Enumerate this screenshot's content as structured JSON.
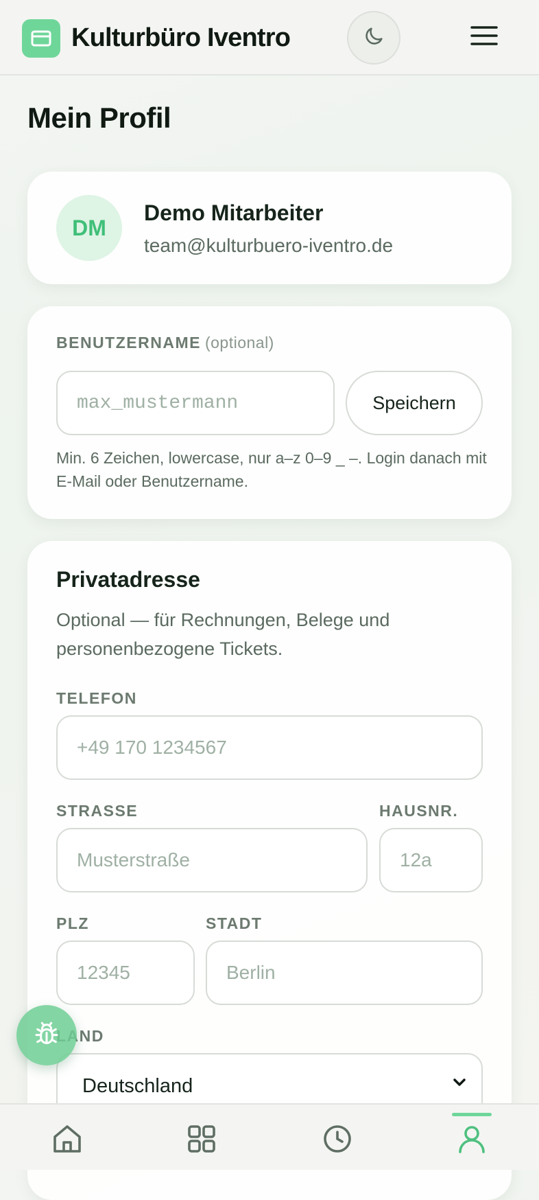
{
  "header": {
    "brand_name": "Kulturbüro Iventro",
    "logo_icon": "credit-card-icon",
    "theme_toggle_icon": "moon-icon",
    "menu_icon": "hamburger-menu-icon"
  },
  "page": {
    "title": "Mein Profil"
  },
  "profile": {
    "initials": "DM",
    "name": "Demo Mitarbeiter",
    "email": "team@kulturbuero-iventro.de"
  },
  "username": {
    "label": "BENUTZERNAME",
    "optional_label": "(optional)",
    "placeholder": "max_mustermann",
    "value": "",
    "save_label": "Speichern",
    "help": "Min. 6 Zeichen, lowercase, nur a–z 0–9 _ –. Login danach mit E-Mail oder Benutzername."
  },
  "address": {
    "title": "Privatadresse",
    "description": "Optional — für Rechnungen, Belege und personenbezogene Tickets.",
    "phone": {
      "label": "TELEFON",
      "placeholder": "+49 170 1234567"
    },
    "street": {
      "label": "STRASSE",
      "placeholder": "Musterstraße"
    },
    "house_number": {
      "label": "HAUSNR.",
      "placeholder": "12a"
    },
    "zip": {
      "label": "PLZ",
      "placeholder": "12345"
    },
    "city": {
      "label": "STADT",
      "placeholder": "Berlin"
    },
    "country": {
      "label": "LAND",
      "value": "Deutschland"
    }
  },
  "fab": {
    "icon": "bug-icon"
  },
  "bottom_nav": {
    "items": [
      {
        "icon": "home-icon",
        "active": false
      },
      {
        "icon": "grid-icon",
        "active": false
      },
      {
        "icon": "clock-icon",
        "active": false
      },
      {
        "icon": "user-icon",
        "active": true
      }
    ],
    "active_color": "#6fd69a"
  },
  "colors": {
    "accent": "#6fd69a",
    "avatar_bg": "#def4e5",
    "avatar_text": "#3fbf78"
  }
}
